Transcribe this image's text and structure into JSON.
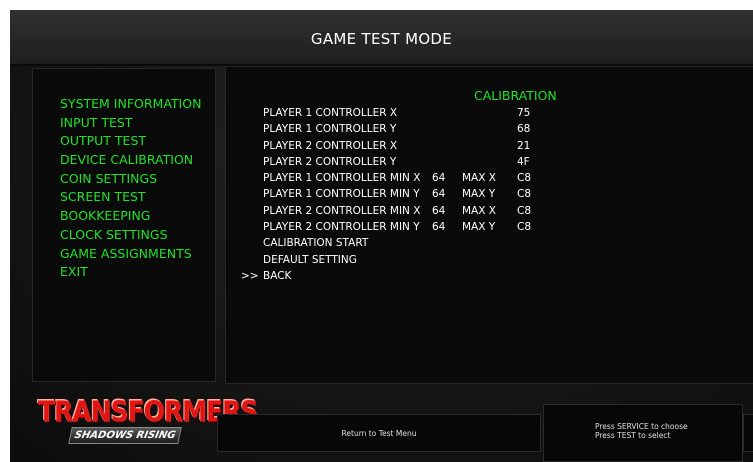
{
  "header": {
    "title": "GAME TEST MODE"
  },
  "menu": {
    "items": [
      "SYSTEM INFORMATION",
      "INPUT TEST",
      "OUTPUT TEST",
      "DEVICE CALIBRATION",
      "COIN SETTINGS",
      "SCREEN TEST",
      "BOOKKEEPING",
      "CLOCK SETTINGS",
      "GAME ASSIGNMENTS",
      "EXIT"
    ]
  },
  "calibration": {
    "heading": "CALIBRATION",
    "cursor": ">>",
    "rows": [
      {
        "label": "PLAYER 1 CONTROLLER X",
        "min": "",
        "max_label": "",
        "value": "75"
      },
      {
        "label": "PLAYER 1 CONTROLLER Y",
        "min": "",
        "max_label": "",
        "value": "68"
      },
      {
        "label": "PLAYER 2 CONTROLLER X",
        "min": "",
        "max_label": "",
        "value": "21"
      },
      {
        "label": "PLAYER 2 CONTROLLER Y",
        "min": "",
        "max_label": "",
        "value": "4F"
      },
      {
        "label": "PLAYER 1 CONTROLLER MIN X",
        "min": "64",
        "max_label": "MAX X",
        "value": "C8"
      },
      {
        "label": "PLAYER 1 CONTROLLER MIN Y",
        "min": "64",
        "max_label": "MAX Y",
        "value": "C8"
      },
      {
        "label": "PLAYER 2 CONTROLLER MIN X",
        "min": "64",
        "max_label": "MAX X",
        "value": "C8"
      },
      {
        "label": "PLAYER 2 CONTROLLER MIN Y",
        "min": "64",
        "max_label": "MAX Y",
        "value": "C8"
      },
      {
        "label": "CALIBRATION START",
        "min": "",
        "max_label": "",
        "value": ""
      },
      {
        "label": "DEFAULT SETTING",
        "min": "",
        "max_label": "",
        "value": ""
      },
      {
        "label": "BACK",
        "min": "",
        "max_label": "",
        "value": "",
        "selected": true
      }
    ]
  },
  "logo": {
    "main": "TRANSFORMERS",
    "sub": "SHADOWS RISING"
  },
  "footer": {
    "left": "Return to Test Menu",
    "right_line1": "Press SERVICE to choose",
    "right_line2": "Press TEST to select"
  },
  "colors": {
    "accent_green": "#22e02a",
    "logo_red": "#e11512",
    "panel_bg": "#0a0a0a",
    "frame_bg": "#161616"
  }
}
